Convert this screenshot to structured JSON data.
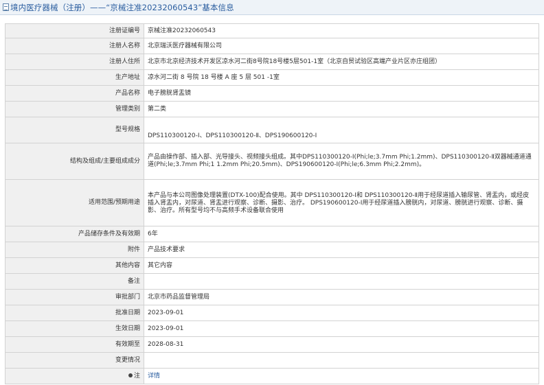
{
  "header": {
    "breadcrumb": "境内医疗器械（注册）——“京械注准20232060543”基本信息",
    "icon": "document-icon"
  },
  "rows": [
    {
      "label": "注册证编号",
      "value": "京械注准20232060543"
    },
    {
      "label": "注册人名称",
      "value": "北京瑞沃医疗器械有限公司"
    },
    {
      "label": "注册人住所",
      "value": "北京市北京经济技术开发区凉水河二街8号院18号楼5层501-1室（北京自贸试验区高端产业片区亦庄组团）"
    },
    {
      "label": "生产地址",
      "value": "凉水河二街 8 号院 18 号楼 A 座 5 层 501 -1室"
    },
    {
      "label": "产品名称",
      "value": "电子膀胱肾盂镜"
    },
    {
      "label": "管理类别",
      "value": "第二类"
    },
    {
      "label": "型号规格",
      "value": "DPS110300120-Ⅰ、DPS110300120-Ⅱ、DPS190600120-Ⅰ"
    },
    {
      "label": "结构及组成/主要组成成分",
      "value": "产品由操作部、插入部、光导接头、视频接头组成。其中DPS110300120-Ⅰ(Phi;le;3.7mm Phi;1.2mm)、DPS110300120-Ⅱ双器械通道通道(Phi;le;3.7mm Phi;1 1.2mm Phi;20.5mm)、DPS190600120-Ⅰ(Phi;le;6.3mm Phi;2.2mm)。"
    },
    {
      "label": "适用范围/预期用途",
      "value": "本产品与本公司图像处理装置(DTX-100)配合使用。其中 DPS110300120-Ⅰ和 DPS110300120-Ⅱ用于经尿道插入输尿管、肾盂内，或经皮插入肾盂内，对尿道、肾盂进行观察、诊断、摄影、治疗。 DPS190600120-Ⅰ用于经尿道插入膀胱内，对尿道、膀胱进行观察、诊断、摄影、治疗。所有型号均不与高频手术设备联合使用"
    },
    {
      "label": "产品储存条件及有效期",
      "value": "6年"
    },
    {
      "label": "附件",
      "value": "产品技术要求"
    },
    {
      "label": "其他内容",
      "value": "其它内容"
    },
    {
      "label": "备注",
      "value": ""
    },
    {
      "label": "审批部门",
      "value": "北京市药品监督管理局"
    },
    {
      "label": "批准日期",
      "value": "2023-09-01"
    },
    {
      "label": "生效日期",
      "value": "2023-09-01"
    },
    {
      "label": "有效期至",
      "value": "2028-08-31"
    },
    {
      "label": "变更情况",
      "value": ""
    },
    {
      "label": "注",
      "value": "详情"
    }
  ]
}
